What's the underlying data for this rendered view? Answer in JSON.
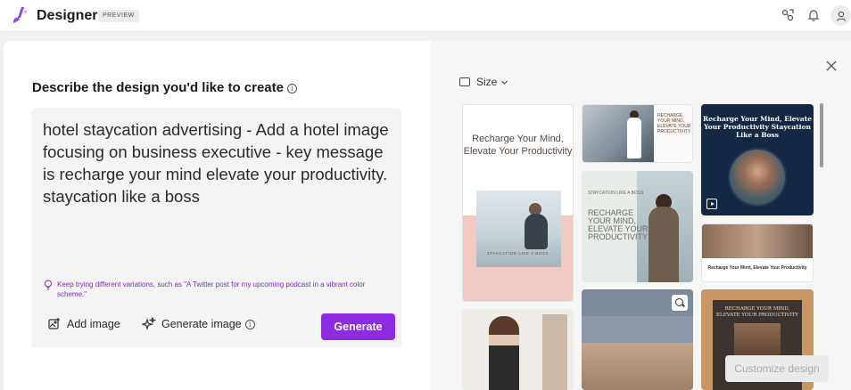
{
  "header": {
    "app_name": "Designer",
    "badge": "PREVIEW",
    "icons": [
      "share-icon",
      "notification-icon",
      "account-icon"
    ]
  },
  "prompt": {
    "heading": "Describe the design you'd like to create",
    "text": "hotel staycation advertising - Add a hotel image focusing on business executive - key message is recharge your mind elevate your productivity. staycation like a boss",
    "hint": "Keep trying different variations, such as \"A Twitter post for my upcoming podcast in a vibrant color scheme.\"",
    "add_image_label": "Add image",
    "generate_image_label": "Generate image",
    "generate_button": "Generate"
  },
  "results": {
    "size_label": "Size",
    "customize_button": "Customize design",
    "thumbnails": {
      "t1_title": "Recharge Your Mind, Elevate Your Productivity",
      "t1_caption": "STAYCATION LIKE A BOSS",
      "t2_text": "RECHARGE YOUR MIND, ELEVATE YOUR PRODUCTIVITY",
      "t3_text": "Recharge Your Mind, Elevate Your Productivity Staycation Like a Boss",
      "t4_small": "STAYCATION LIKE A BOSS",
      "t4_text": "RECHARGE YOUR MIND, ELEVATE YOUR PRODUCTIVITY",
      "t5_text": "Recharge Your Mind, Elevate Your Productivity",
      "t8_text": "RECHARGE YOUR MIND, ELEVATE YOUR PRODUCTIVITY"
    }
  },
  "colors": {
    "accent": "#8c2be2",
    "hint_text": "#7a2fb5"
  }
}
